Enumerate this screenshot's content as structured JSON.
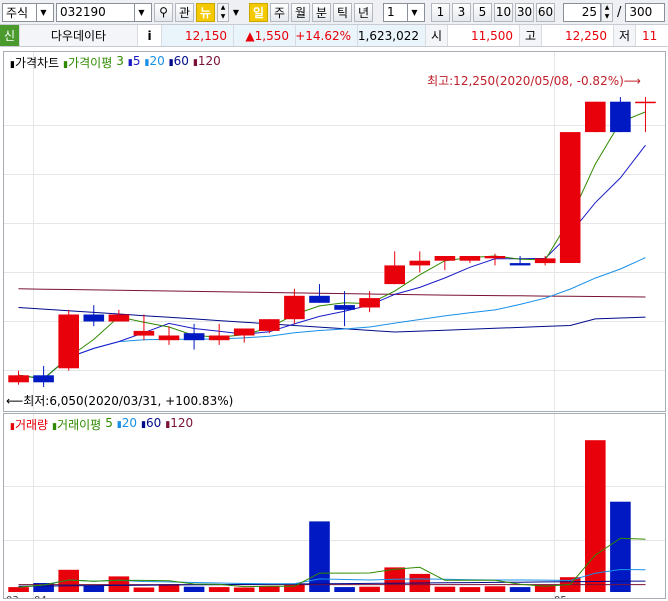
{
  "toolbar": {
    "market_select": "주식",
    "stock_code": "032190",
    "relation_label": "관",
    "news_label": "뉴",
    "period_buttons": [
      "일",
      "주",
      "월",
      "분",
      "틱",
      "년"
    ],
    "unit_value": "1",
    "interval_buttons": [
      "1",
      "3",
      "5",
      "10",
      "30",
      "60"
    ],
    "view_count": "25",
    "separator": "/",
    "total_count": "300"
  },
  "info": {
    "credit_badge": "신",
    "stock_name": "다우데이타",
    "info_button": "i",
    "price": "12,150",
    "change": "▲1,550",
    "change_rate": "+14.62%",
    "volume": "1,623,022",
    "open_label": "시",
    "open_value": "11,500",
    "high_label": "고",
    "high_value": "12,250",
    "low_label": "저",
    "low_value": "11"
  },
  "price_chart": {
    "legend": {
      "title": "가격차트",
      "ma_label": "가격이평",
      "ma_periods": [
        "3",
        "5",
        "20",
        "60",
        "120"
      ]
    },
    "max_annotation": "최고:12,250(2020/05/08, -0.82%)",
    "min_annotation": "최저:6,050(2020/03/31, +100.83%)"
  },
  "volume_chart": {
    "legend": {
      "title": "거래량",
      "ma_label": "거래이평",
      "ma_periods": [
        "5",
        "20",
        "60",
        "120"
      ]
    }
  },
  "x_axis": {
    "labels": [
      "03",
      "04",
      "05"
    ]
  },
  "colors": {
    "up": "#e8000b",
    "down": "#0019c2",
    "ma3": "#2f8a00",
    "ma5": "#1a1ac8",
    "ma20": "#1890e8",
    "ma60": "#000b8c",
    "ma120": "#7a1138",
    "annotation": "#c0202a"
  },
  "chart_data": {
    "type": "candlestick",
    "x": [
      "03/30",
      "03/31",
      "04/01",
      "04/02",
      "04/03",
      "04/06",
      "04/07",
      "04/08",
      "04/09",
      "04/10",
      "04/13",
      "04/14",
      "04/16",
      "04/17",
      "04/20",
      "04/21",
      "04/22",
      "04/23",
      "04/24",
      "04/27",
      "04/28",
      "04/29",
      "05/04",
      "05/06",
      "05/07",
      "05/08"
    ],
    "open": [
      6150,
      6300,
      6450,
      7600,
      7450,
      7150,
      7050,
      7200,
      7050,
      7150,
      7250,
      7500,
      8000,
      7800,
      7750,
      8250,
      8650,
      8750,
      8750,
      8800,
      8700,
      8700,
      8700,
      11500,
      12150,
      12150
    ],
    "high": [
      6400,
      6500,
      7700,
      7800,
      7700,
      7600,
      7350,
      7400,
      7400,
      7300,
      7500,
      8150,
      8250,
      8100,
      8100,
      8950,
      8950,
      8850,
      8850,
      8900,
      8850,
      8850,
      11500,
      12150,
      12250,
      12250
    ],
    "low": [
      6100,
      6050,
      6400,
      7350,
      7450,
      7050,
      6950,
      6850,
      6950,
      7000,
      7200,
      7400,
      7850,
      7350,
      7650,
      8250,
      8500,
      8550,
      8700,
      8650,
      8650,
      8650,
      8700,
      11500,
      11500,
      11500
    ],
    "close": [
      6300,
      6150,
      7600,
      7450,
      7600,
      7250,
      7150,
      7050,
      7150,
      7300,
      7500,
      8000,
      7850,
      7700,
      7950,
      8650,
      8750,
      8850,
      8850,
      8850,
      8650,
      8800,
      11500,
      12150,
      11500,
      12150
    ],
    "volume": [
      60000,
      110000,
      270000,
      80000,
      190000,
      55000,
      95000,
      65000,
      60000,
      55000,
      70000,
      105000,
      860000,
      60000,
      65000,
      300000,
      220000,
      65000,
      60000,
      70000,
      60000,
      90000,
      180000,
      1850000,
      1100000,
      0
    ],
    "ylim_price": [
      5900,
      12700
    ],
    "ylim_volume": [
      0,
      1950000
    ]
  }
}
